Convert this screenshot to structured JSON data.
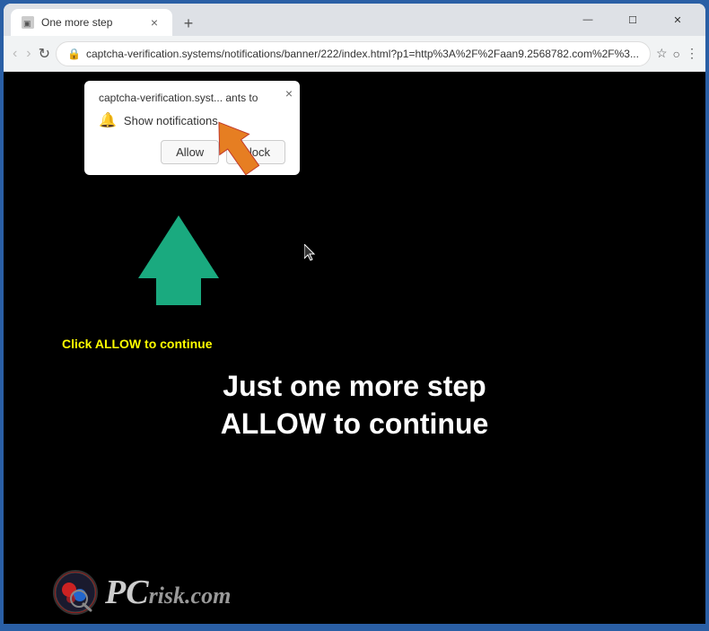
{
  "browser": {
    "tab": {
      "favicon_label": "page-icon",
      "title": "One more step",
      "close_label": "×"
    },
    "new_tab_label": "+",
    "window_controls": {
      "minimize": "—",
      "maximize": "☐",
      "close": "✕"
    },
    "nav": {
      "back": "‹",
      "forward": "›",
      "refresh": "↻"
    },
    "url": "captcha-verification.systems/notifications/banner/222/index.html?p1=http%3A%2F%2Faan9.2568782.com%2F%3...",
    "url_actions": {
      "star": "☆",
      "account": "○",
      "menu": "⋮"
    }
  },
  "notification_popup": {
    "site_text": "captcha-verification.syst... ants to",
    "bell_icon": "🔔",
    "show_text": "Show notifications",
    "close_label": "×",
    "allow_label": "Allow",
    "block_label": "Block"
  },
  "page": {
    "click_allow_text": "Click ALLOW to continue",
    "heading_line1": "Just one more step",
    "heading_line2": "ALLOW to continue"
  },
  "logo": {
    "pc_text": "PC",
    "logo_text": "risk.com"
  },
  "colors": {
    "accent_green": "#1aaa7f",
    "orange_arrow": "#e67e22",
    "background": "#000000",
    "popup_bg": "#ffffff",
    "browser_frame": "#2a5fa5"
  }
}
